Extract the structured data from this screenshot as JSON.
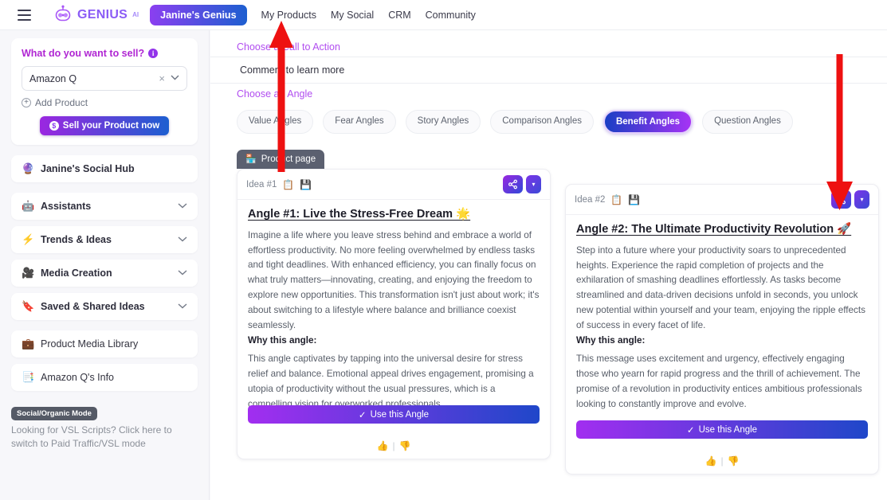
{
  "topbar": {
    "menu_icon": "hamburger-icon",
    "brand": "GENIUS",
    "brand_sup": "AI",
    "active_pill": "Janine's Genius",
    "links": [
      "My Products",
      "My Social",
      "CRM",
      "Community"
    ]
  },
  "sidebar": {
    "sell_title": "What do you want to sell?",
    "info_icon": "i",
    "product_value": "Amazon Q",
    "clear_icon": "×",
    "chevron_icon": "⌄",
    "add_product": "Add Product",
    "sell_button": "Sell your Product now",
    "items": [
      {
        "label": "Janine's Social Hub",
        "icon": "🔮",
        "chevron": "",
        "name": "janines-social-hub"
      },
      {
        "label": "Assistants",
        "icon": "🤖",
        "chevron": "⌄",
        "name": "assistants"
      },
      {
        "label": "Trends & Ideas",
        "icon": "⚡",
        "chevron": "⌄",
        "name": "trends-ideas"
      },
      {
        "label": "Media Creation",
        "icon": "🎥",
        "chevron": "⌄",
        "name": "media-creation"
      },
      {
        "label": "Saved & Shared Ideas",
        "icon": "🔖",
        "chevron": "⌄",
        "name": "saved-shared-ideas"
      },
      {
        "label": "Product Media Library",
        "icon": "💼",
        "chevron": "",
        "name": "product-media-library"
      },
      {
        "label": "Amazon Q's Info",
        "icon": "📑",
        "chevron": "",
        "name": "amazon-q-info"
      }
    ],
    "mode_badge": "Social/Organic Mode",
    "vsl_note": "Looking for VSL Scripts? Click here to switch to Paid Traffic/VSL mode"
  },
  "main": {
    "cta_label": "Choose a Call to Action",
    "cta_value": "Comment to learn more",
    "angle_label": "Choose an Angle",
    "angle_chips": [
      {
        "label": "Value Angles",
        "active": false
      },
      {
        "label": "Fear Angles",
        "active": false
      },
      {
        "label": "Story Angles",
        "active": false
      },
      {
        "label": "Comparison Angles",
        "active": false
      },
      {
        "label": "Benefit Angles",
        "active": true
      },
      {
        "label": "Question Angles",
        "active": false
      }
    ],
    "tab_badge": "Product page",
    "tab_icon": "🏪",
    "cards": [
      {
        "idea_tag": "Idea #1",
        "copy_icon": "📋",
        "save_icon": "💾",
        "share_icon": "share-icon",
        "dropdown_icon": "▾",
        "title": "Angle #1: Live the Stress-Free Dream 🌟",
        "body": "Imagine a life where you leave stress behind and embrace a world of effortless productivity. No more feeling overwhelmed by endless tasks and tight deadlines. With enhanced efficiency, you can finally focus on what truly matters—innovating, creating, and enjoying the freedom to explore new opportunities. This transformation isn't just about work; it's about switching to a lifestyle where balance and brilliance coexist seamlessly.",
        "why_label": "Why this angle:",
        "why_text": "This angle captivates by tapping into the universal desire for stress relief and balance. Emotional appeal drives engagement, promising a utopia of productivity without the usual pressures, which is a compelling vision for overworked professionals.",
        "use_button": "Use this Angle",
        "check_icon": "✓",
        "thumb_up": "👍",
        "thumb_down": "👎"
      },
      {
        "idea_tag": "Idea #2",
        "copy_icon": "📋",
        "save_icon": "💾",
        "share_icon": "share-icon",
        "dropdown_icon": "▾",
        "title": "Angle #2: The Ultimate Productivity Revolution 🚀",
        "body": "Step into a future where your productivity soars to unprecedented heights. Experience the rapid completion of projects and the exhilaration of smashing deadlines effortlessly. As tasks become streamlined and data-driven decisions unfold in seconds, you unlock new potential within yourself and your team, enjoying the ripple effects of success in every facet of life.",
        "why_label": "Why this angle:",
        "why_text": "This message uses excitement and urgency, effectively engaging those who yearn for rapid progress and the thrill of achievement. The promise of a revolution in productivity entices ambitious professionals looking to constantly improve and evolve.",
        "use_button": "Use this Angle",
        "check_icon": "✓",
        "thumb_up": "👍",
        "thumb_down": "👎"
      }
    ]
  },
  "annotations": {
    "arrow_color": "#ee1111",
    "arrow_left_target": "My Social",
    "arrow_right_target": "share-button-card-2"
  }
}
